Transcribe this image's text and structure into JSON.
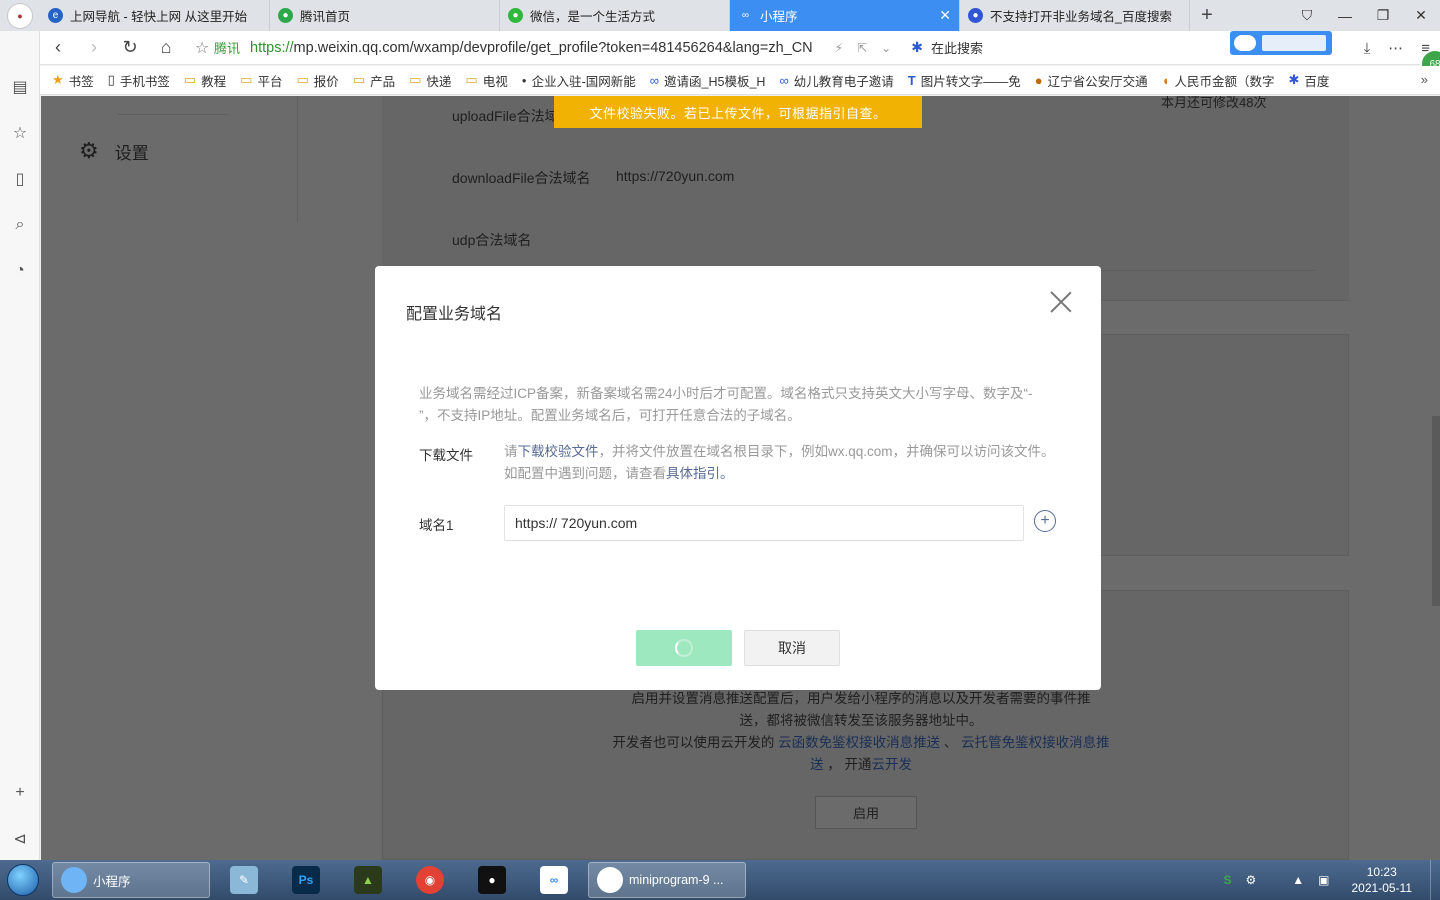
{
  "browser": {
    "tabs": [
      {
        "label": "上网导航 - 轻快上网 从这里开始",
        "icon": "ie-icon",
        "color": "#2563c9"
      },
      {
        "label": "腾讯首页",
        "icon": "tencent-icon",
        "color": "#2da84a"
      },
      {
        "label": "微信，是一个生活方式",
        "icon": "wechat-icon",
        "color": "#2fb83c"
      },
      {
        "label": "小程序",
        "icon": "miniprogram-icon",
        "color": "#ffffff"
      },
      {
        "label": "不支持打开非业务域名_百度搜索",
        "icon": "baidu-icon",
        "color": "#3155d4"
      }
    ],
    "address": {
      "site_label": "腾讯",
      "url_scheme": "https://",
      "url_rest": "mp.weixin.qq.com/wxamp/devprofile/get_profile?token=481456264&lang=zh_CN",
      "search_label": "在此搜索"
    },
    "side_badge": "68",
    "bookmarks": [
      {
        "label": "书签",
        "icon": "star-icon"
      },
      {
        "label": "手机书签",
        "icon": "phone-icon"
      },
      {
        "label": "教程",
        "icon": "folder-icon"
      },
      {
        "label": "平台",
        "icon": "folder-icon"
      },
      {
        "label": "报价",
        "icon": "folder-icon"
      },
      {
        "label": "产品",
        "icon": "folder-icon"
      },
      {
        "label": "快递",
        "icon": "folder-icon"
      },
      {
        "label": "电视",
        "icon": "folder-icon"
      },
      {
        "label": "企业入驻-国网新能",
        "icon": "sgcc-icon"
      },
      {
        "label": "邀请函_H5模板_H",
        "icon": "infinity-icon"
      },
      {
        "label": "幼儿教育电子邀请",
        "icon": "infinity-icon"
      },
      {
        "label": "图片转文字——免",
        "icon": "t-icon"
      },
      {
        "label": "辽宁省公安厅交通",
        "icon": "police-icon"
      },
      {
        "label": "人民币金额（数字",
        "icon": "c-icon"
      },
      {
        "label": "百度",
        "icon": "baidu-icon"
      }
    ]
  },
  "page": {
    "left_nav": {
      "settings_label": "设置"
    },
    "rows": {
      "upload_label": "uploadFile合法域名",
      "download_label": "downloadFile合法域名",
      "download_value": "https://720yun.com",
      "udp_label": "udp合法域名",
      "right_note": "本月还可修改48次"
    },
    "push": {
      "line1": "启用并设置消息推送配置后，用户发给小程序的消息以及开发者需要的事件推",
      "line2": "送，都将被微信转发至该服务器地址中。",
      "line3_prefix": "开发者也可以使用云开发的 ",
      "link1": "云函数免鉴权接收消息推送",
      "sep": " 、 ",
      "link2": "云托管免鉴权接收消息推送",
      "line4_mid": " ， 开通",
      "link3": "云开发",
      "enable_label": "启用"
    }
  },
  "toast": {
    "text": "文件校验失败。若已上传文件，可根据指引自查。"
  },
  "modal": {
    "title": "配置业务域名",
    "desc": "业务域名需经过ICP备案，新备案域名需24小时后才可配置。域名格式只支持英文大小写字母、数字及“- ”，不支持IP地址。配置业务域名后，可打开任意合法的子域名。",
    "download": {
      "label": "下载文件",
      "prefix": "请",
      "link": "下载校验文件",
      "middle": "，并将文件放置在域名根目录下，例如wx.qq.com，并确保可以访问该文件。如配置中遇到问题，请查看",
      "guide_link": "具体指引。"
    },
    "domain": {
      "label": "域名1",
      "value": "https:// 720yun.com"
    },
    "cancel_label": "取消"
  },
  "taskbar": {
    "active_task": "小程序",
    "terminal_task": "miniprogram-9 ...",
    "time": "10:23",
    "date": "2021-05-11"
  }
}
